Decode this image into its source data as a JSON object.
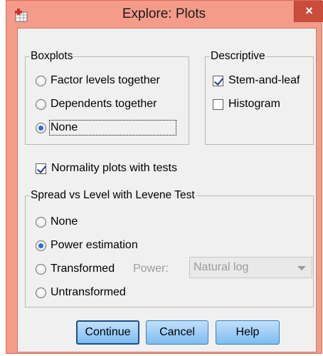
{
  "window": {
    "title": "Explore: Plots",
    "close_symbol": "×"
  },
  "boxplots": {
    "legend": "Boxplots",
    "options": [
      {
        "label": "Factor levels together",
        "mnemonic": "F",
        "checked": false
      },
      {
        "label": "Dependents together",
        "mnemonic": "D",
        "checked": false
      },
      {
        "label": "None",
        "mnemonic": "N",
        "checked": true
      }
    ]
  },
  "descriptive": {
    "legend": "Descriptive",
    "stem_and_leaf": {
      "label": "Stem-and-leaf",
      "checked": true
    },
    "histogram": {
      "label": "Histogram",
      "checked": false
    }
  },
  "normality": {
    "label": "Normality plots with tests",
    "checked": true
  },
  "spread": {
    "legend": "Spread vs Level with Levene Test",
    "options": [
      {
        "label": "None",
        "checked": false
      },
      {
        "label": "Power estimation",
        "checked": true
      },
      {
        "label": "Transformed",
        "checked": false
      },
      {
        "label": "Untransformed",
        "checked": false
      }
    ],
    "power_label": "Power:",
    "power_value": "Natural log"
  },
  "buttons": {
    "continue": "Continue",
    "cancel": "Cancel",
    "help": "Help"
  },
  "colors": {
    "frame": "#f49b8a",
    "close": "#c94d3b",
    "button": "#7fbcf1",
    "accent": "#2f6bd1"
  }
}
